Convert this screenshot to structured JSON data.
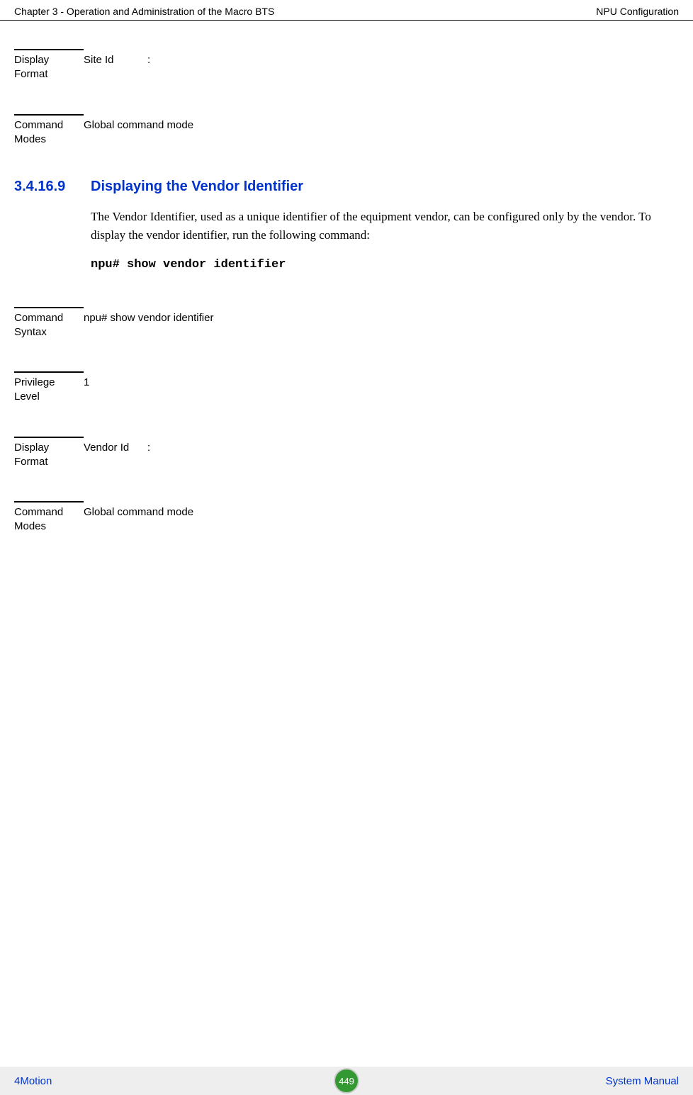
{
  "header": {
    "left": "Chapter 3 - Operation and Administration of the Macro BTS",
    "right": "NPU Configuration"
  },
  "block1": {
    "label": "Display Format",
    "key": "Site Id",
    "sep": ":"
  },
  "block2": {
    "label": "Command Modes",
    "value": "Global command mode"
  },
  "section": {
    "num": "3.4.16.9",
    "title": "Displaying the Vendor Identifier",
    "body": "The Vendor Identifier, used as a unique identifier of the equipment vendor, can be configured only by the vendor. To display the vendor identifier, run the following command:",
    "command": "npu# show vendor identifier"
  },
  "block3": {
    "label": "Command Syntax",
    "value": "npu# show vendor identifier"
  },
  "block4": {
    "label": "Privilege Level",
    "value": "1"
  },
  "block5": {
    "label": "Display Format",
    "key": "Vendor Id",
    "sep": ":"
  },
  "block6": {
    "label": "Command Modes",
    "value": "Global command mode"
  },
  "footer": {
    "left": "4Motion",
    "center": "449",
    "right": "System Manual"
  }
}
